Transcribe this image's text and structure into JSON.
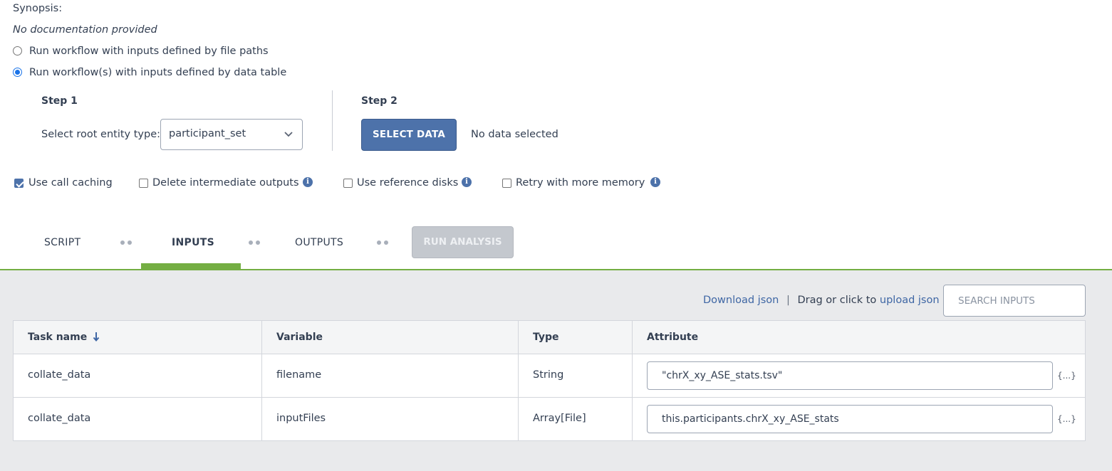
{
  "synopsis": {
    "label": "Synopsis:",
    "documentation": "No documentation provided"
  },
  "run_mode": {
    "option_file_paths": "Run workflow with inputs defined by file paths",
    "option_data_table": "Run workflow(s) with inputs defined by data table",
    "selected": "data_table"
  },
  "step1": {
    "title": "Step 1",
    "label": "Select root entity type:",
    "entity_type": "participant_set"
  },
  "step2": {
    "title": "Step 2",
    "select_button": "SELECT DATA",
    "status": "No data selected"
  },
  "options": {
    "call_caching": {
      "label": "Use call caching",
      "checked": true
    },
    "delete_intermediate": {
      "label": "Delete intermediate outputs",
      "checked": false
    },
    "reference_disks": {
      "label": "Use reference disks",
      "checked": false
    },
    "retry_memory": {
      "label": "Retry with more memory",
      "checked": false
    }
  },
  "tabs": {
    "script": "SCRIPT",
    "inputs": "INPUTS",
    "outputs": "OUTPUTS",
    "active": "INPUTS",
    "run_button": "RUN ANALYSIS"
  },
  "toolbar": {
    "download_json": "Download json",
    "separator": "|",
    "drag_text": "Drag or click to",
    "upload_json": "upload json",
    "search_placeholder": "SEARCH INPUTS"
  },
  "table": {
    "headers": {
      "task_name": "Task name",
      "variable": "Variable",
      "type": "Type",
      "attribute": "Attribute"
    },
    "sort_icon": "arrow-down-icon",
    "rows": [
      {
        "task": "collate_data",
        "variable": "filename",
        "type": "String",
        "attribute": "\"chrX_xy_ASE_stats.tsv\"",
        "brace": "{...}"
      },
      {
        "task": "collate_data",
        "variable": "inputFiles",
        "type": "Array[File]",
        "attribute": "this.participants.chrX_xy_ASE_stats",
        "brace": "{...}"
      }
    ]
  },
  "colors": {
    "primary": "#4d72aa",
    "accent_green": "#74ae43",
    "link": "#3e66a4",
    "text": "#333f52",
    "panel_bg": "#e9eaec"
  }
}
